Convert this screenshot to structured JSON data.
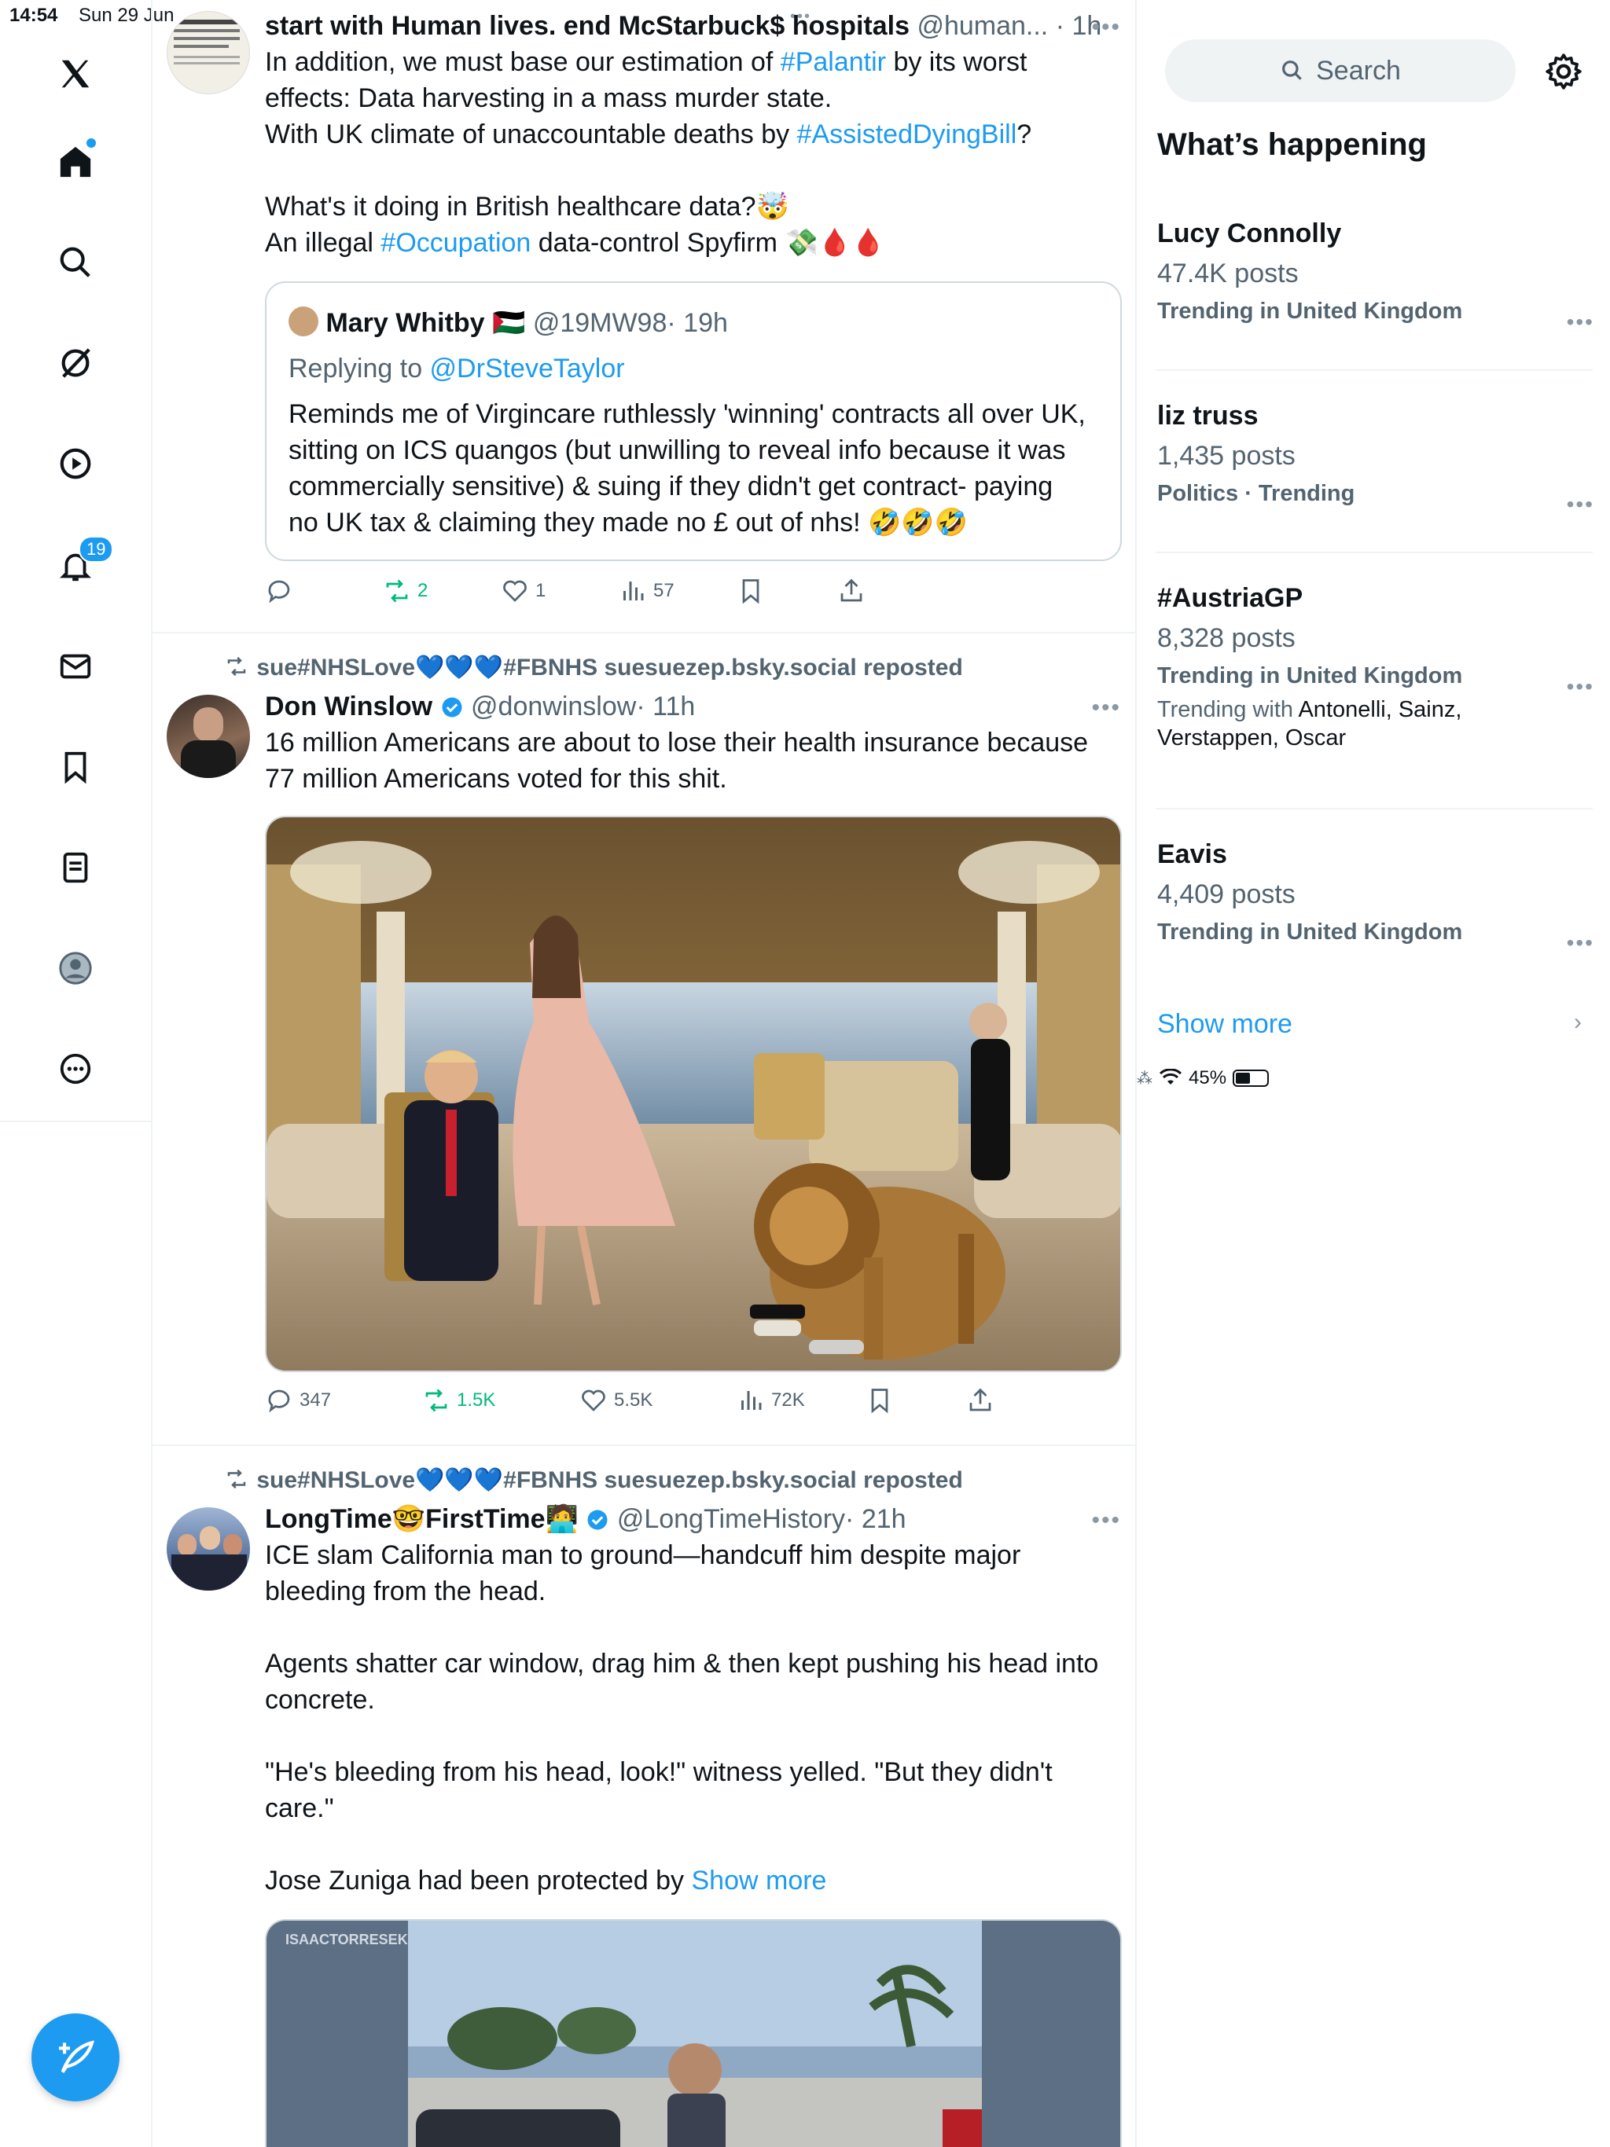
{
  "status_bar": {
    "time": "14:54",
    "date": "Sun 29 Jun",
    "battery": "45%"
  },
  "nav": {
    "notifications_badge": "19"
  },
  "feed": {
    "tweet1": {
      "name": "start with Human lives. end McStarbuck$ hospitals",
      "handle": "@human...",
      "time": "· 1h",
      "line1_pre": "In addition, we must base our estimation of ",
      "line1_tag": "#Palantir",
      "line1_post": " by its worst",
      "line2": "effects: Data harvesting in a mass murder state.",
      "line3_pre": "With UK climate of unaccountable deaths by ",
      "line3_tag": "#AssistedDyingBill",
      "line3_post": "?",
      "line4": "What's it doing in British healthcare data?🤯",
      "line5_pre": "An illegal ",
      "line5_tag": "#Occupation",
      "line5_post": " data-control Spyfirm 💸🩸🩸",
      "quote": {
        "name": "Mary Whitby 🇵🇸",
        "handle": "@19MW98",
        "time": "· 19h",
        "replying_label": "Replying to ",
        "replying_to": "@DrSteveTaylor",
        "text1": "Reminds me of Virgincare ruthlessly 'winning' contracts all over UK,",
        "text2": "sitting on ICS quangos (but unwilling to reveal info because it was",
        "text3": "commercially sensitive) & suing if they didn't get contract- paying",
        "text4": "no UK tax & claiming they made no £ out of nhs! 🤣🤣🤣"
      },
      "reposts": "2",
      "likes": "1",
      "views": "57"
    },
    "tweet2": {
      "reposted_by": "sue#NHSLove💙💙💙#FBNHS suesuezep.bsky.social reposted",
      "name": "Don Winslow",
      "handle": "@donwinslow",
      "time": "· 11h",
      "text1": "16 million Americans are about to lose their health insurance because",
      "text2": "77 million Americans voted for this shit.",
      "replies": "347",
      "reposts": "1.5K",
      "likes": "5.5K",
      "views": "72K"
    },
    "tweet3": {
      "reposted_by": "sue#NHSLove💙💙💙#FBNHS suesuezep.bsky.social reposted",
      "name": "LongTime🤓FirstTime🧑‍💻",
      "handle": "@LongTimeHistory",
      "time": "· 21h",
      "text1": "ICE slam California man to ground—handcuff him despite major",
      "text2": "bleeding from the head.",
      "text3": "Agents shatter car window, drag him & then kept pushing his head into",
      "text4": "concrete.",
      "text5": "\"He's bleeding from his head, look!\" witness yelled. \"But they didn't",
      "text6": "care.\"",
      "text7_pre": "Jose Zuniga had been protected by ",
      "text7_link": "Show more",
      "video_watermark": "ISAACTORRESEK"
    }
  },
  "right": {
    "search_placeholder": "Search",
    "heading": "What’s happening",
    "trends": [
      {
        "title": "Lucy Connolly",
        "count": "47.4K posts",
        "meta": "Trending in United Kingdom"
      },
      {
        "title": "liz truss",
        "count": "1,435 posts",
        "meta": "Politics · Trending"
      },
      {
        "title": "#AustriaGP",
        "count": "8,328 posts",
        "meta": "Trending in United Kingdom",
        "with_label": "Trending with ",
        "with_names": "Antonelli, Sainz,",
        "with_names2": "Verstappen, Oscar"
      },
      {
        "title": "Eavis",
        "count": "4,409 posts",
        "meta": "Trending in United Kingdom"
      }
    ],
    "show_more": "Show more"
  },
  "colors": {
    "accent": "#1d9bf0",
    "repost_green": "#00ba7c",
    "muted": "#536471",
    "divider": "#eff3f4"
  }
}
